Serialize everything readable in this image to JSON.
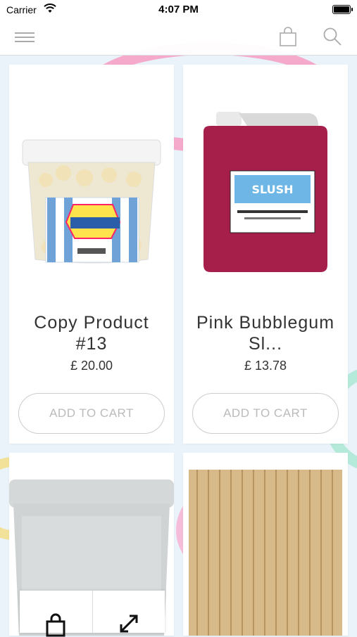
{
  "status": {
    "carrier": "Carrier",
    "time": "4:07 PM"
  },
  "nav": {
    "menu_icon": "hamburger-icon",
    "bag_icon": "shopping-bag-icon",
    "search_icon": "search-icon"
  },
  "products": [
    {
      "title": "Copy Product #13",
      "price": "£ 20.00",
      "button": "ADD TO CART",
      "image": "popcorn-tub"
    },
    {
      "title": "Pink Bubblegum Sl...",
      "price": "£ 13.78",
      "button": "ADD TO CART",
      "image": "slush-syrup-bottle"
    },
    {
      "image": "empty-tub"
    },
    {
      "image": "wooden-sticks"
    }
  ],
  "floating_actions": {
    "left_icon": "shopping-bag-icon",
    "right_icon": "expand-icon"
  }
}
